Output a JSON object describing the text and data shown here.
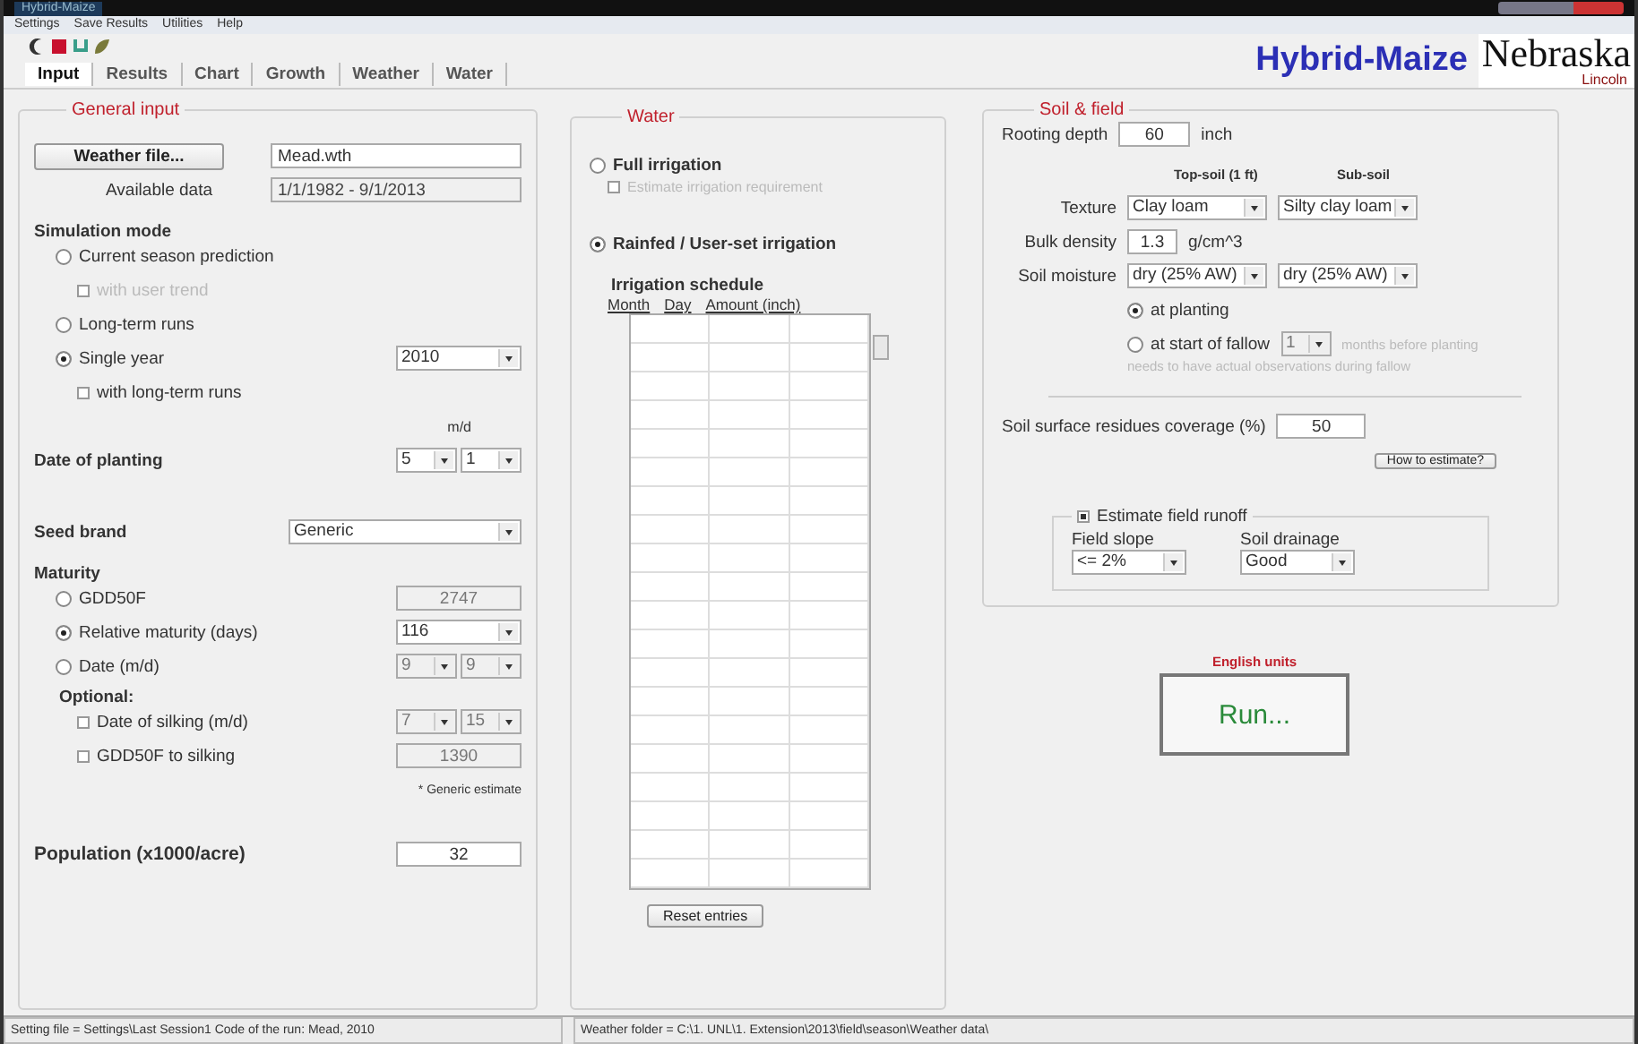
{
  "window": {
    "title": "Hybrid-Maize"
  },
  "menu": [
    "Settings",
    "Save Results",
    "Utilities",
    "Help"
  ],
  "tabs": [
    {
      "label": "Input",
      "selected": true
    },
    {
      "label": "Results",
      "selected": false
    },
    {
      "label": "Chart",
      "selected": false
    },
    {
      "label": "Growth",
      "selected": false
    },
    {
      "label": "Weather",
      "selected": false
    },
    {
      "label": "Water",
      "selected": false
    }
  ],
  "brand": {
    "title": "Hybrid-Maize",
    "logo": "Nebraska",
    "sub": "Lincoln"
  },
  "general_input": {
    "title": "General input",
    "weather_file": {
      "button": "Weather file...",
      "value": "Mead.wth"
    },
    "available_data": {
      "label": "Available data",
      "value": "1/1/1982 - 9/1/2013"
    },
    "simulation_mode": {
      "label": "Simulation mode",
      "options": [
        {
          "label": "Current season prediction",
          "selected": false,
          "sub": {
            "label": "with user trend",
            "checked": false,
            "disabled": true
          }
        },
        {
          "label": "Long-term runs",
          "selected": false
        },
        {
          "label": "Single year",
          "selected": true,
          "year": "2010",
          "sub": {
            "label": "with long-term runs",
            "checked": false,
            "disabled": false
          }
        }
      ]
    },
    "planting": {
      "label": "Date of planting",
      "unit": "m/d",
      "month": "5",
      "day": "1"
    },
    "seed_brand": {
      "label": "Seed brand",
      "value": "Generic"
    },
    "maturity": {
      "label": "Maturity",
      "options": [
        {
          "kind": "text",
          "label": "GDD50F",
          "selected": false,
          "value": "2747"
        },
        {
          "kind": "select",
          "label": "Relative maturity (days)",
          "selected": true,
          "value": "116"
        },
        {
          "kind": "date",
          "label": "Date (m/d)",
          "selected": false,
          "month": "9",
          "day": "9"
        }
      ]
    },
    "optional": {
      "label": "Optional:",
      "items": [
        {
          "kind": "date",
          "label": "Date of silking (m/d)",
          "checked": false,
          "month": "7",
          "day": "15"
        },
        {
          "kind": "text",
          "label": "GDD50F to silking",
          "checked": false,
          "value": "1390"
        }
      ],
      "note": "* Generic estimate"
    },
    "population": {
      "label": "Population (x1000/acre)",
      "value": "32"
    }
  },
  "water": {
    "title": "Water",
    "options": [
      {
        "label": "Full irrigation",
        "selected": false
      },
      {
        "label": "Rainfed / User-set irrigation",
        "selected": true
      }
    ],
    "estimate": {
      "label": "Estimate irrigation requirement",
      "checked": false,
      "disabled": true
    },
    "schedule": {
      "title": "Irrigation schedule",
      "columns": [
        "Month",
        "Day",
        "Amount (inch)"
      ]
    },
    "reset_button": "Reset entries"
  },
  "soil": {
    "title": "Soil & field",
    "rooting": {
      "label": "Rooting depth",
      "value": "60",
      "unit": "inch"
    },
    "columns": [
      "Top-soil (1 ft)",
      "Sub-soil"
    ],
    "texture": {
      "label": "Texture",
      "values": [
        "Clay loam",
        "Silty clay loam"
      ]
    },
    "bulk": {
      "label": "Bulk density",
      "value": "1.3",
      "unit": "g/cm^3"
    },
    "moisture": {
      "label": "Soil moisture",
      "values": [
        "dry (25% AW)",
        "dry (25% AW)"
      ],
      "options": [
        {
          "label": "at planting",
          "selected": true
        },
        {
          "label": "at start of fallow",
          "selected": false,
          "value": "1",
          "note": "months before planting"
        }
      ],
      "hint": "needs to have actual observations during fallow"
    },
    "residues": {
      "label": "Soil surface residues coverage (%)",
      "value": "50",
      "button": "How to estimate?"
    },
    "runoff": {
      "label": "Estimate field runoff",
      "checked": true,
      "slope": {
        "label": "Field slope",
        "value": "<= 2%"
      },
      "drainage": {
        "label": "Soil drainage",
        "value": "Good"
      }
    }
  },
  "run": {
    "units": "English units",
    "button": "Run..."
  },
  "status_bar": [
    "Setting file = Settings\\Last Session1 Code of the run: Mead, 2010",
    "Weather folder = C:\\1. UNL\\1. Extension\\2013\\field\\season\\Weather data\\"
  ]
}
